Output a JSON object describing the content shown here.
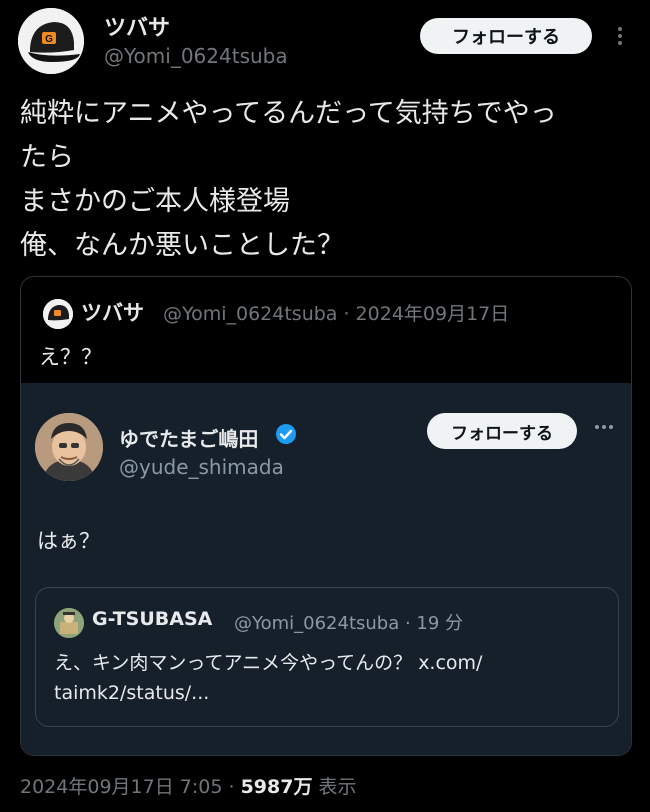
{
  "author": {
    "name": "ツバサ",
    "handle": "@Yomi_0624tsuba",
    "follow_label": "フォローする"
  },
  "tweet": {
    "text": "純粋にアニメやってるんだって気持ちでやっ\nたら\nまさかのご本人様登場\n俺、なんか悪いことした？"
  },
  "quote": {
    "name": "ツバサ",
    "handle_date": "@Yomi_0624tsuba · 2024年09月17日",
    "text": "え？？",
    "embed": {
      "name": "ゆでたまご嶋田",
      "handle": "@yude_shimada",
      "follow_label": "フォローする",
      "text": "はぁ？",
      "inner": {
        "name": "G-TSUBASA",
        "handle_date": "@Yomi_0624tsuba · 19 分",
        "text": "え、キン肉マンってアニメ今やってんの？ x.com/\ntaimk2/status/..."
      }
    }
  },
  "footer": {
    "timestamp": "2024年09月17日 7:05",
    "separator": "·",
    "views_count": "5987万",
    "views_label": "表示"
  },
  "colors": {
    "background": "#000000",
    "embed_background": "#15202b",
    "text": "#e7e9ea",
    "muted": "#71767b",
    "verified_blue": "#1d9bf0"
  },
  "icons": {
    "more": "ellipsis-vertical-icon",
    "more_embed": "ellipsis-horizontal-icon",
    "verified": "verified-badge-icon"
  }
}
